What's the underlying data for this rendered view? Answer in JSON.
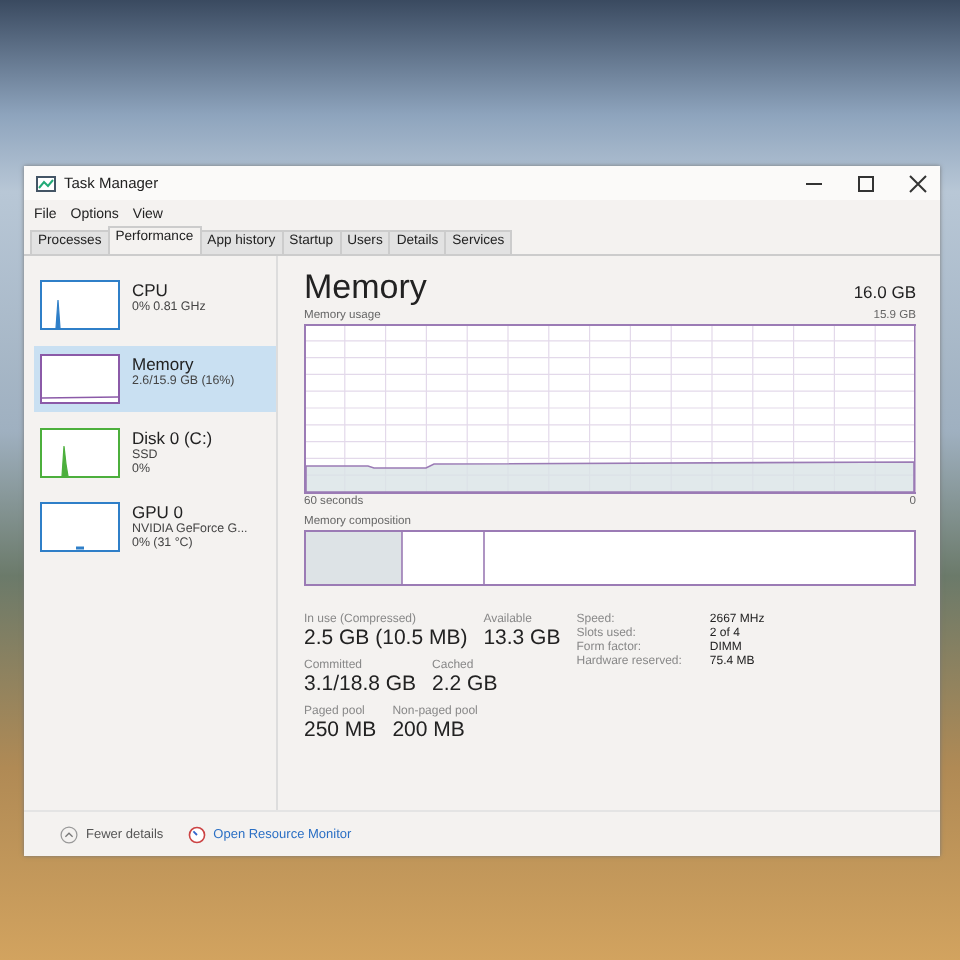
{
  "window": {
    "title": "Task Manager"
  },
  "menu": [
    "File",
    "Options",
    "View"
  ],
  "tabs": [
    {
      "label": "Processes",
      "selected": false
    },
    {
      "label": "Performance",
      "selected": true
    },
    {
      "label": "App history",
      "selected": false
    },
    {
      "label": "Startup",
      "selected": false
    },
    {
      "label": "Users",
      "selected": false
    },
    {
      "label": "Details",
      "selected": false
    },
    {
      "label": "Services",
      "selected": false
    }
  ],
  "sidebar": {
    "items": [
      {
        "name": "CPU",
        "lines": [
          "0% 0.81 GHz"
        ],
        "color": "#2f7fc8",
        "selected": false
      },
      {
        "name": "Memory",
        "lines": [
          "2.6/15.9 GB (16%)"
        ],
        "color": "#8b5aa8",
        "selected": true
      },
      {
        "name": "Disk 0 (C:)",
        "lines": [
          "SSD",
          "0%"
        ],
        "color": "#4caf3c",
        "selected": false
      },
      {
        "name": "GPU 0",
        "lines": [
          "NVIDIA GeForce G...",
          "0% (31 °C)"
        ],
        "color": "#2f7fc8",
        "selected": false
      }
    ]
  },
  "detail": {
    "title": "Memory",
    "total": "16.0 GB",
    "usage_label": "Memory usage",
    "usage_max": "15.9 GB",
    "time_label": "60 seconds",
    "usage_min": "0",
    "composition_label": "Memory composition",
    "stats": [
      {
        "label": "In use (Compressed)",
        "value": "2.5 GB (10.5 MB)"
      },
      {
        "label": "Available",
        "value": "13.3 GB"
      },
      {
        "label": "Committed",
        "value": "3.1/18.8 GB"
      },
      {
        "label": "Cached",
        "value": "2.2 GB"
      },
      {
        "label": "Paged pool",
        "value": "250 MB"
      },
      {
        "label": "Non-paged pool",
        "value": "200 MB"
      }
    ],
    "properties": [
      {
        "label": "Speed:",
        "value": "2667 MHz"
      },
      {
        "label": "Slots used:",
        "value": "2 of 4"
      },
      {
        "label": "Form factor:",
        "value": "DIMM"
      },
      {
        "label": "Hardware reserved:",
        "value": "75.4 MB"
      }
    ]
  },
  "footer": {
    "fewer_details": "Fewer details",
    "resource_monitor": "Open Resource Monitor"
  }
}
